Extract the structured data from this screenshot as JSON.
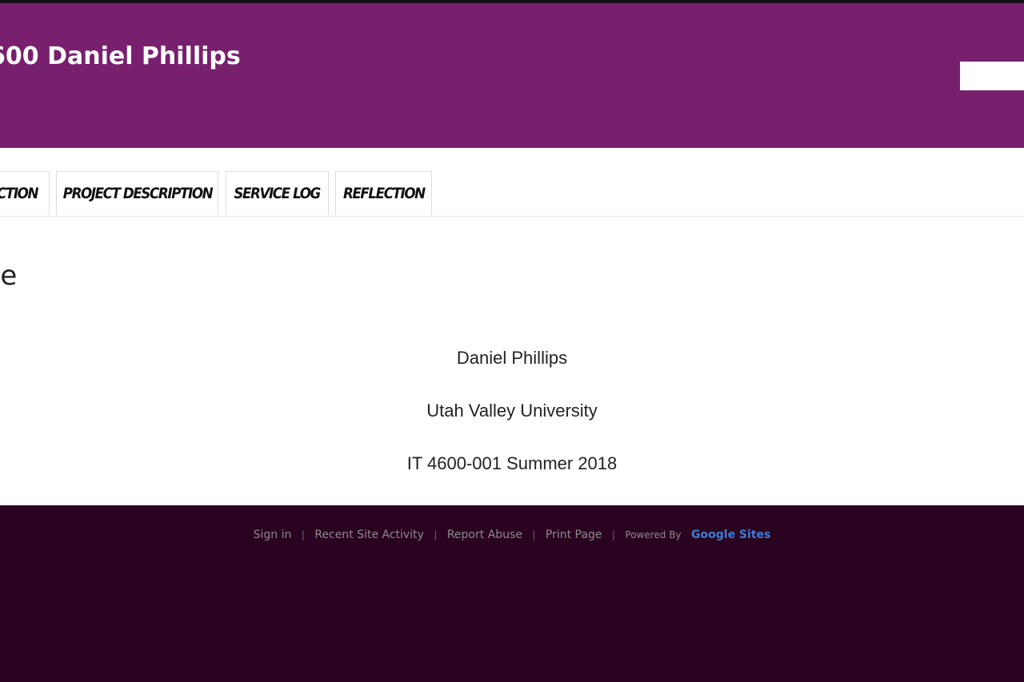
{
  "header": {
    "site_title": "600 Daniel Phillips"
  },
  "nav": {
    "tabs": [
      {
        "label": "ction"
      },
      {
        "label": "Project Description"
      },
      {
        "label": "Service Log"
      },
      {
        "label": "Reflection"
      }
    ]
  },
  "main": {
    "page_title": "age",
    "lines": [
      "Daniel Phillips",
      "Utah Valley University",
      "IT 4600-001 Summer 2018"
    ]
  },
  "footer": {
    "sign_in": "Sign in",
    "recent_activity": "Recent Site Activity",
    "report_abuse": "Report Abuse",
    "print_page": "Print Page",
    "separator": "|",
    "powered_by": "Powered By",
    "google_sites": "Google Sites"
  },
  "colors": {
    "header_bg": "#78206e",
    "footer_bg": "#2a0320",
    "link_accent": "#3d7ed8"
  }
}
